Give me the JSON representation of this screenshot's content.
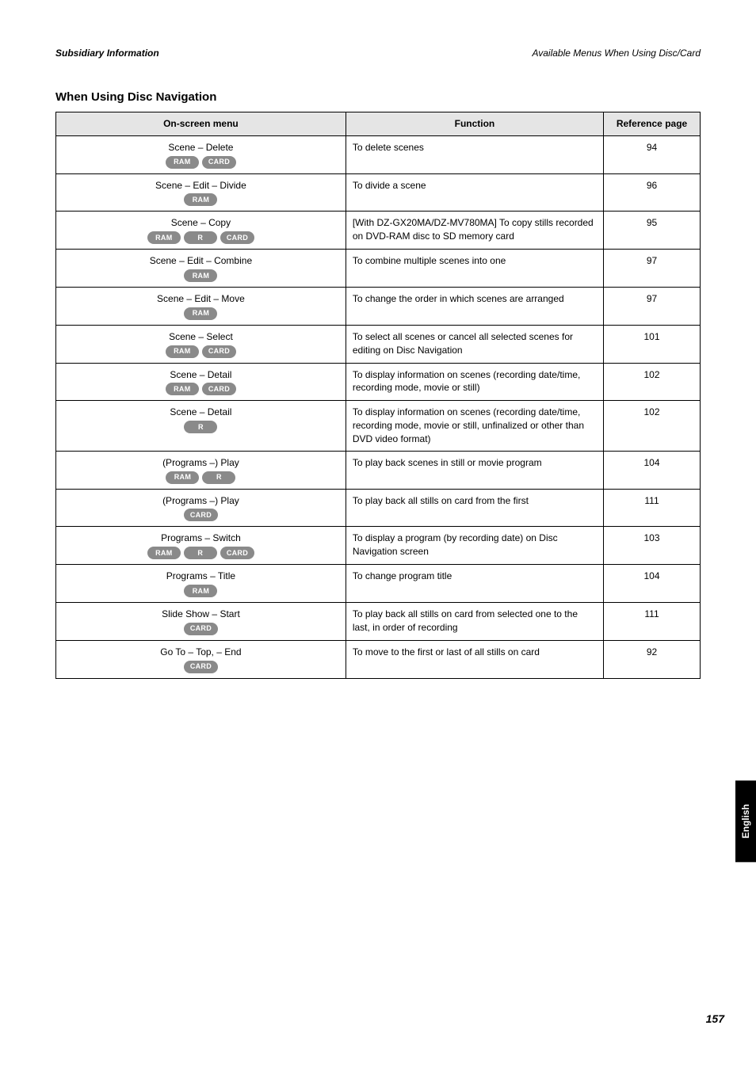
{
  "header": {
    "left": "Subsidiary Information",
    "right": "Available Menus When Using Disc/Card"
  },
  "section_title": "When Using Disc Navigation",
  "columns": [
    "On-screen menu",
    "Function",
    "Reference page"
  ],
  "rows": [
    {
      "item": "Scene – Delete",
      "badges": [
        "RAM",
        "CARD"
      ],
      "function": "To delete scenes",
      "page": "94"
    },
    {
      "item": "Scene – Edit – Divide",
      "badges": [
        "RAM"
      ],
      "function": "To divide a scene",
      "page": "96"
    },
    {
      "item": "Scene – Copy",
      "badges": [
        "RAM",
        "R",
        "CARD"
      ],
      "function": "[With DZ-GX20MA/DZ-MV780MA] To copy stills recorded on DVD-RAM disc to SD memory card",
      "page": "95"
    },
    {
      "item": "Scene – Edit – Combine",
      "badges": [
        "RAM"
      ],
      "function": "To combine multiple scenes into one",
      "page": "97"
    },
    {
      "item": "Scene – Edit – Move",
      "badges": [
        "RAM"
      ],
      "function": "To change the order in which scenes are arranged",
      "page": "97"
    },
    {
      "item": "Scene – Select",
      "badges": [
        "RAM",
        "CARD"
      ],
      "function": "To select all scenes or cancel all selected scenes for editing on Disc Navigation",
      "page": "101"
    },
    {
      "item": "Scene – Detail",
      "badges": [
        "RAM",
        "CARD"
      ],
      "function": "To display information on scenes (recording date/time, recording mode, movie or still)",
      "page": "102"
    },
    {
      "item": "Scene – Detail",
      "badges": [
        "R"
      ],
      "function": "To display information on scenes (recording date/time, recording mode, movie or still, unfinalized or other than DVD video format)",
      "page": "102"
    },
    {
      "item": "(Programs –) Play",
      "badges": [
        "RAM",
        "R"
      ],
      "function": "To play back scenes in still or movie program",
      "page": "104"
    },
    {
      "item": "(Programs –) Play",
      "badges": [
        "CARD"
      ],
      "function": "To play back all stills on card from the first",
      "page": "111"
    },
    {
      "item": "Programs – Switch",
      "badges": [
        "RAM",
        "R",
        "CARD"
      ],
      "function": "To display a program (by recording date) on Disc Navigation screen",
      "page": "103"
    },
    {
      "item": "Programs – Title",
      "badges": [
        "RAM"
      ],
      "function": "To change program title",
      "page": "104"
    },
    {
      "item": "Slide Show – Start",
      "badges": [
        "CARD"
      ],
      "function": "To play back all stills on card from selected one to the last, in order of recording",
      "page": "111"
    },
    {
      "item": "Go To – Top, – End",
      "badges": [
        "CARD"
      ],
      "function": "To move to the first or last of all stills on card",
      "page": "92"
    }
  ],
  "side_tab": "English",
  "page_number": "157"
}
